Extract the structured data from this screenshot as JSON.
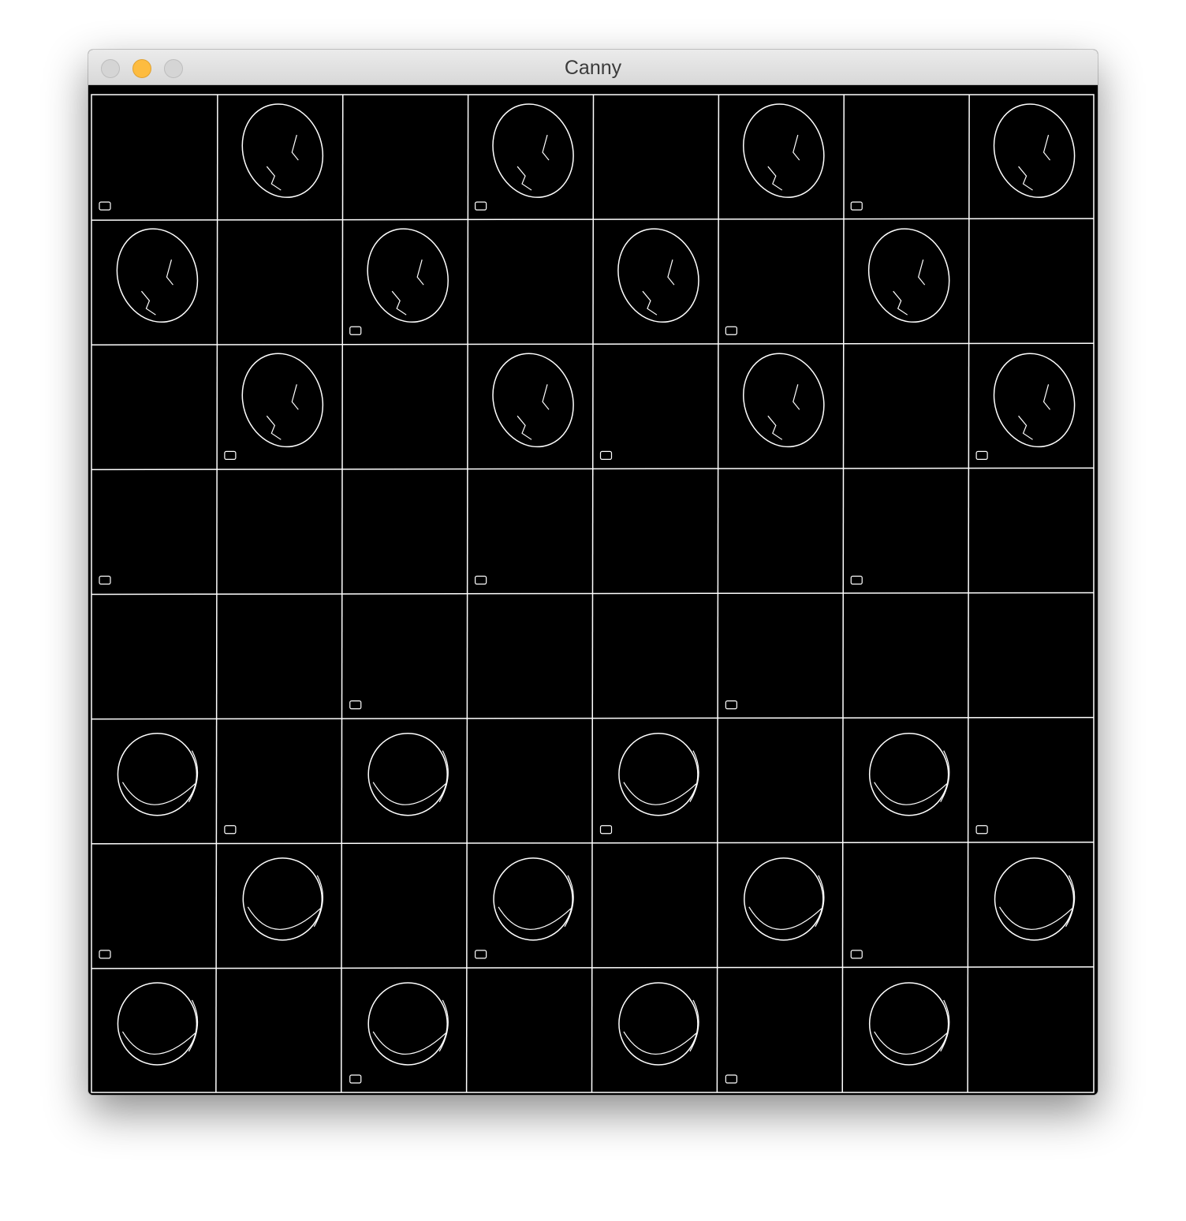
{
  "window": {
    "title": "Canny"
  },
  "controls": {
    "close_color": "#d5d5d5",
    "minimize_color": "#fdbc40",
    "zoom_color": "#d5d5d5"
  },
  "image": {
    "description_icon": "canny-edge-image",
    "board": {
      "rows": 8,
      "cols": 8,
      "pieces": [
        {
          "row": 0,
          "col": 1
        },
        {
          "row": 0,
          "col": 3
        },
        {
          "row": 0,
          "col": 5
        },
        {
          "row": 0,
          "col": 7
        },
        {
          "row": 1,
          "col": 0
        },
        {
          "row": 1,
          "col": 2
        },
        {
          "row": 1,
          "col": 4
        },
        {
          "row": 1,
          "col": 6
        },
        {
          "row": 2,
          "col": 1
        },
        {
          "row": 2,
          "col": 3
        },
        {
          "row": 2,
          "col": 5
        },
        {
          "row": 2,
          "col": 7
        },
        {
          "row": 5,
          "col": 0
        },
        {
          "row": 5,
          "col": 2
        },
        {
          "row": 5,
          "col": 4
        },
        {
          "row": 5,
          "col": 6
        },
        {
          "row": 6,
          "col": 1
        },
        {
          "row": 6,
          "col": 3
        },
        {
          "row": 6,
          "col": 5
        },
        {
          "row": 6,
          "col": 7
        },
        {
          "row": 7,
          "col": 0
        },
        {
          "row": 7,
          "col": 2
        },
        {
          "row": 7,
          "col": 4
        },
        {
          "row": 7,
          "col": 6
        }
      ]
    },
    "edge_color": "#ffffff",
    "background_color": "#000000"
  }
}
